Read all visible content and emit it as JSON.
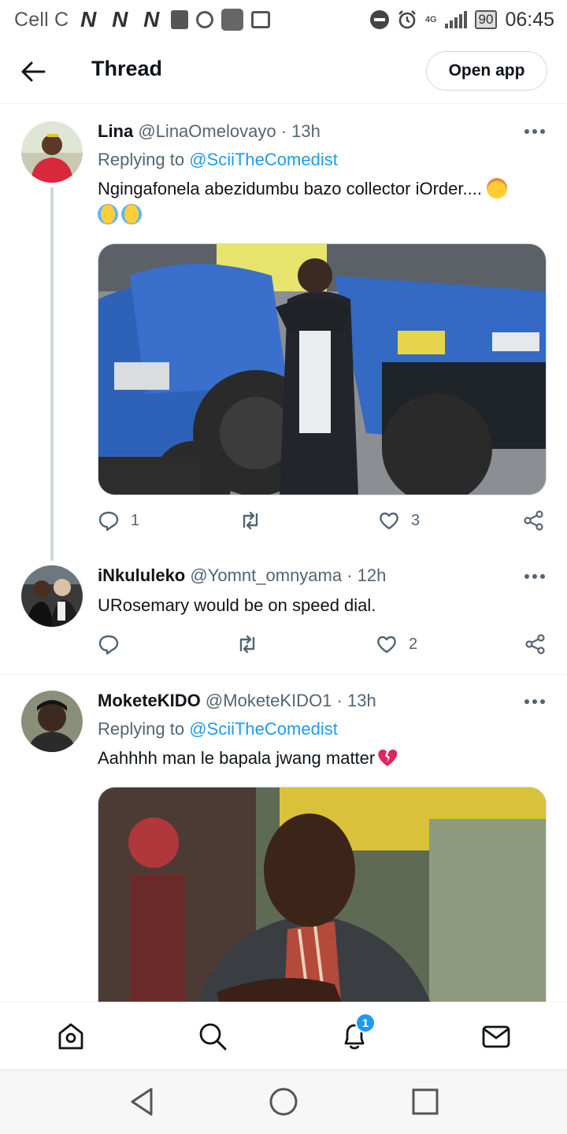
{
  "status_bar": {
    "carrier": "Cell C",
    "network_glyph": "N",
    "net_type": "4G",
    "battery": "90",
    "time": "06:45"
  },
  "header": {
    "title": "Thread",
    "open_app_label": "Open app"
  },
  "tweets": [
    {
      "name": "Lina",
      "handle": "@LinaOmelovayo",
      "time": "· 13h",
      "replying_prefix": "Replying to",
      "replying_to": "@SciiTheComedist",
      "text": "Ngingafonela abezidumbu bazo collector iOrder....",
      "emojis": [
        "exploding-head-emoji",
        "crying-face-emoji",
        "crying-face-emoji"
      ],
      "has_media": true,
      "replies": "1",
      "retweets": "",
      "likes": "3"
    },
    {
      "name": "iNkululeko",
      "handle": "@Yomnt_omnyama",
      "time": "· 12h",
      "text": "URosemary would be on speed dial.",
      "has_media": false,
      "replies": "",
      "retweets": "",
      "likes": "2"
    },
    {
      "name": "MoketeKIDO",
      "handle": "@MoketeKIDO1",
      "time": "· 13h",
      "replying_prefix": "Replying to",
      "replying_to": "@SciiTheComedist",
      "text": "Aahhhh man le bapala jwang matter",
      "emojis": [
        "broken-heart-emoji"
      ],
      "has_media": true
    }
  ],
  "bottom_nav": {
    "items": [
      "home-icon",
      "search-icon",
      "notifications-icon",
      "messages-icon"
    ],
    "notification_badge": "1"
  },
  "colors": {
    "accent": "#1d9bf0",
    "text": "#0f1419",
    "secondary": "#536471",
    "border": "#cfd9de"
  }
}
